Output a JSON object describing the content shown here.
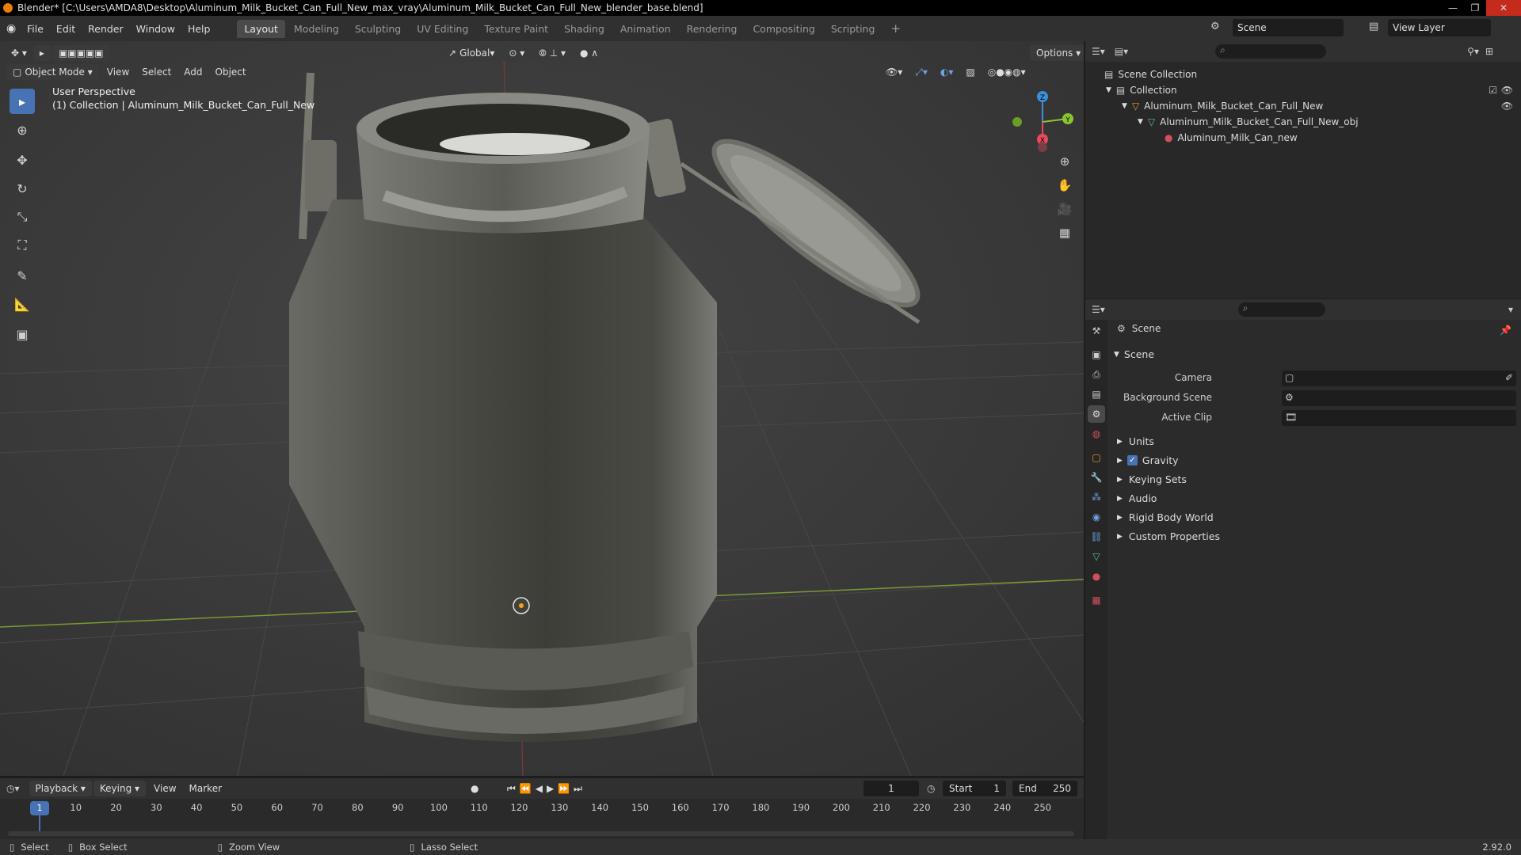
{
  "window": {
    "title": "Blender* [C:\\Users\\AMDA8\\Desktop\\Aluminum_Milk_Bucket_Can_Full_New_max_vray\\Aluminum_Milk_Bucket_Can_Full_New_blender_base.blend]"
  },
  "menu": [
    "File",
    "Edit",
    "Render",
    "Window",
    "Help"
  ],
  "workspaces": [
    "Layout",
    "Modeling",
    "Sculpting",
    "UV Editing",
    "Texture Paint",
    "Shading",
    "Animation",
    "Rendering",
    "Compositing",
    "Scripting"
  ],
  "active_workspace": "Layout",
  "scene_name": "Scene",
  "view_layer": "View Layer",
  "viewport": {
    "mode": "Object Mode",
    "menus": [
      "View",
      "Select",
      "Add",
      "Object"
    ],
    "transform_orientation": "Global",
    "options_label": "Options",
    "perspective_label": "User Perspective",
    "collection_label": "(1) Collection | Aluminum_Milk_Bucket_Can_Full_New",
    "gizmo": {
      "x": "X",
      "y": "Y",
      "z": "Z"
    }
  },
  "outliner": {
    "root": "Scene Collection",
    "items": [
      {
        "label": "Collection",
        "level": 1,
        "icon": "collection-icon"
      },
      {
        "label": "Aluminum_Milk_Bucket_Can_Full_New",
        "level": 2,
        "icon": "empty-object-icon"
      },
      {
        "label": "Aluminum_Milk_Bucket_Can_Full_New_obj",
        "level": 3,
        "icon": "mesh-icon"
      },
      {
        "label": "Aluminum_Milk_Can_new",
        "level": 4,
        "icon": "material-icon"
      }
    ]
  },
  "properties": {
    "context": "Scene",
    "panel_title": "Scene",
    "fields": [
      {
        "label": "Camera"
      },
      {
        "label": "Background Scene"
      },
      {
        "label": "Active Clip"
      }
    ],
    "sections": [
      {
        "label": "Units",
        "checkbox": false
      },
      {
        "label": "Gravity",
        "checkbox": true
      },
      {
        "label": "Keying Sets",
        "checkbox": false
      },
      {
        "label": "Audio",
        "checkbox": false
      },
      {
        "label": "Rigid Body World",
        "checkbox": false
      },
      {
        "label": "Custom Properties",
        "checkbox": false
      }
    ]
  },
  "timeline": {
    "menus": [
      "Playback",
      "Keying",
      "View",
      "Marker"
    ],
    "current_frame": "1",
    "start_label": "Start",
    "start": "1",
    "end_label": "End",
    "end": "250",
    "ticks": [
      "10",
      "20",
      "30",
      "40",
      "50",
      "60",
      "70",
      "80",
      "90",
      "100",
      "110",
      "120",
      "130",
      "140",
      "150",
      "160",
      "170",
      "180",
      "190",
      "200",
      "210",
      "220",
      "230",
      "240",
      "250"
    ]
  },
  "status": {
    "select": "Select",
    "box_select": "Box Select",
    "zoom_view": "Zoom View",
    "lasso_select": "Lasso Select",
    "version": "2.92.0"
  },
  "colors": {
    "accent": "#4772b3",
    "axis_x": "#e84a5a",
    "axis_y": "#8ac531",
    "axis_z": "#3d8fdc"
  }
}
